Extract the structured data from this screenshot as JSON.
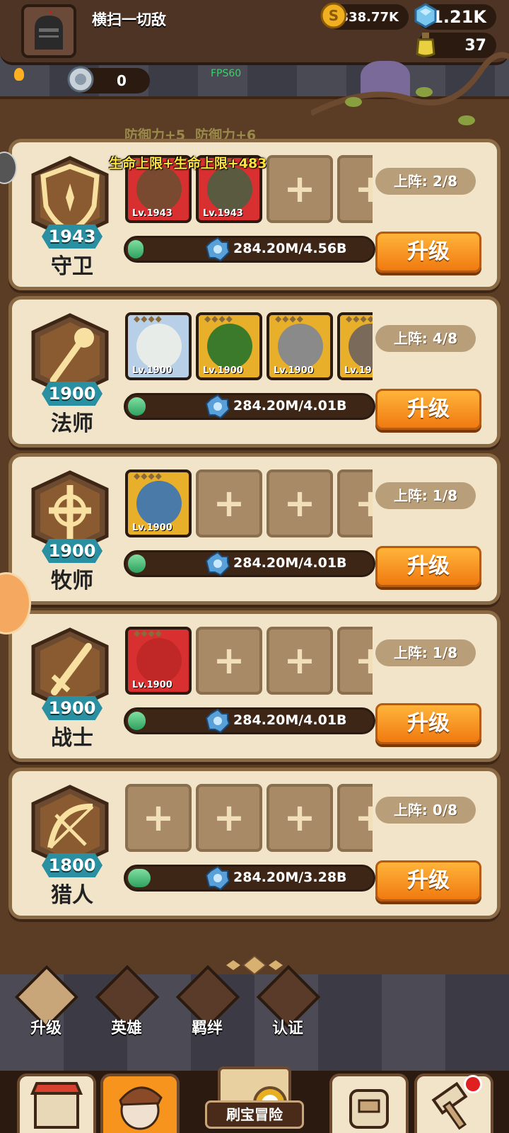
{
  "header": {
    "player_name": "横扫一切敌",
    "coins": "338.77K",
    "gems": "1.21K",
    "potions": "37",
    "silver": "0",
    "fps": "FPS60"
  },
  "bonuses": {
    "defense_1": "防御力+5",
    "defense_2": "防御力+6",
    "hp": "生命上限+生命上限+483"
  },
  "classes": [
    {
      "name": "守卫",
      "level": "1943",
      "deploy": "上阵: 2/8",
      "progress": "284.20M/4.56B",
      "progress_fraction": 0.06,
      "upgrade": "升级",
      "heroes": [
        {
          "lv": "Lv.1943",
          "bg": "#d83030",
          "face": "#7a4a30"
        },
        {
          "lv": "Lv.1943",
          "bg": "#d83030",
          "face": "#5a5a40"
        }
      ]
    },
    {
      "name": "法师",
      "level": "1900",
      "deploy": "上阵: 4/8",
      "progress": "284.20M/4.01B",
      "progress_fraction": 0.07,
      "upgrade": "升级",
      "heroes": [
        {
          "lv": "Lv.1900",
          "bg": "#b8cfe8",
          "face": "#e8ece8"
        },
        {
          "lv": "Lv.1900",
          "bg": "#e8b02a",
          "face": "#3a7a2a"
        },
        {
          "lv": "Lv.1900",
          "bg": "#e8b02a",
          "face": "#8a8a8a"
        },
        {
          "lv": "Lv.19",
          "bg": "#e8b02a",
          "face": "#7a6a5a"
        }
      ]
    },
    {
      "name": "牧师",
      "level": "1900",
      "deploy": "上阵: 1/8",
      "progress": "284.20M/4.01B",
      "progress_fraction": 0.07,
      "upgrade": "升级",
      "heroes": [
        {
          "lv": "Lv.1900",
          "bg": "#e8b02a",
          "face": "#4a7aa8"
        }
      ]
    },
    {
      "name": "战士",
      "level": "1900",
      "deploy": "上阵: 1/8",
      "progress": "284.20M/4.01B",
      "progress_fraction": 0.07,
      "upgrade": "升级",
      "heroes": [
        {
          "lv": "Lv.1900",
          "bg": "#d83030",
          "face": "#c02828"
        }
      ]
    },
    {
      "name": "猎人",
      "level": "1800",
      "deploy": "上阵: 0/8",
      "progress": "284.20M/3.28B",
      "progress_fraction": 0.09,
      "upgrade": "升级",
      "heroes": []
    }
  ],
  "tabs": [
    {
      "label": "升级",
      "active": true
    },
    {
      "label": "英雄",
      "active": false
    },
    {
      "label": "羁绊",
      "active": false
    },
    {
      "label": "认证",
      "active": false
    }
  ],
  "nav": {
    "center_label": "刷宝冒险"
  },
  "icons": {
    "coin": "coin-icon",
    "gem": "gem-icon",
    "potion": "potion-icon",
    "silver": "silver-coin-icon",
    "shield": "shield-icon",
    "staff": "staff-icon",
    "cross": "holy-cross-icon",
    "sword": "sword-icon",
    "bow": "bow-icon"
  },
  "colors": {
    "upgrade_button": "#f7941d",
    "level_badge": "#2a8fa0",
    "card_bg": "#f1e4c8"
  }
}
